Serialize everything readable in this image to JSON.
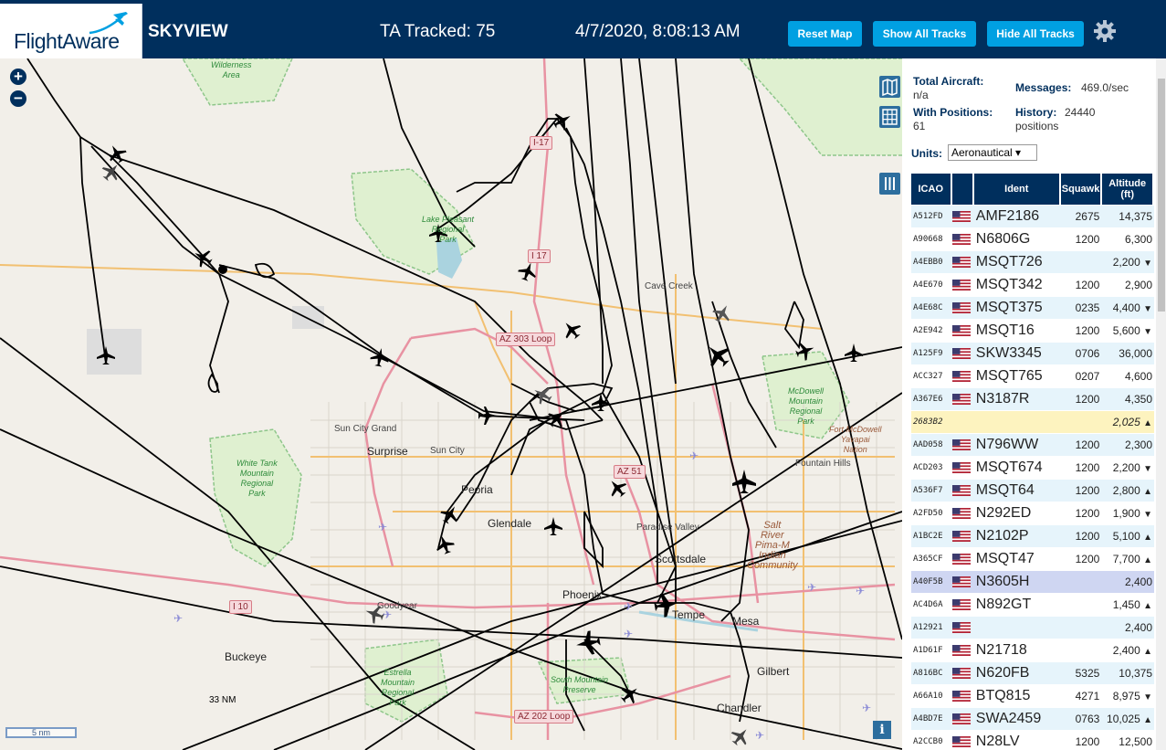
{
  "header": {
    "logo": "FlightAware",
    "title": "SKYVIEW",
    "tracked": "TA Tracked: 75",
    "clock": "4/7/2020, 8:08:13 AM",
    "buttons": {
      "reset": "Reset Map",
      "show": "Show All Tracks",
      "hide": "Hide All Tracks"
    }
  },
  "map": {
    "zoom_in": "+",
    "zoom_out": "−",
    "info": "i",
    "scale_33": "33 NM",
    "scale_bar": "5 nm",
    "labels": {
      "cave_creek": "Cave Creek",
      "sun_city_grand": "Sun City Grand",
      "surprise": "Surprise",
      "sun_city": "Sun City",
      "peoria": "Peoria",
      "glendale": "Glendale",
      "paradise_valley": "Paradise Valley",
      "scottsdale": "Scottsdale",
      "phoenix": "Phoenix",
      "tempe": "Tempe",
      "mesa": "Mesa",
      "gilbert": "Gilbert",
      "chandler": "Chandler",
      "goodyear": "Goodyear",
      "buckeye": "Buckeye",
      "fountain_hills": "Fountain Hills"
    },
    "parks": {
      "wilderness": "River Canyon\nWilderness\nArea",
      "lake_pleasant": "Lake Pleasant\nRegional\nPark",
      "white_tank": "White Tank\nMountain\nRegional\nPark",
      "mcdowell": "McDowell\nMountain\nRegional\nPark",
      "estrella": "Estrella\nMountain\nRegional\nPark",
      "south_mountain": "South Mountain\nPreserve"
    },
    "tribal": {
      "fort_mcdowell": "Fort McDowell\nYavapai\nNation",
      "salt_river": "Salt\nRiver\nPima-M\nIndian\nCommunity"
    },
    "shields": {
      "i17a": "I-17",
      "i17b": "I 17",
      "az303": "AZ 303 Loop",
      "az51": "AZ 51",
      "i10": "I 10",
      "az202": "AZ 202 Loop"
    }
  },
  "panel": {
    "total_aircraft_label": "Total Aircraft:",
    "total_aircraft_value": "n/a",
    "with_positions_label": "With Positions:",
    "with_positions_value": "61",
    "messages_label": "Messages:",
    "messages_value": "469.0/sec",
    "history_label": "History:",
    "history_value": "24440",
    "history_unit": "positions",
    "units_label": "Units:",
    "units_value": "Aeronautical ▾",
    "columns": {
      "icao": "ICAO",
      "ident": "Ident",
      "squawk": "Squawk",
      "altitude": "Altitude",
      "altitude_unit": "(ft)"
    },
    "rows": [
      {
        "icao": "A512FD",
        "ident": "AMF2186",
        "squawk": "2675",
        "alt": "14,375",
        "trend": ""
      },
      {
        "icao": "A90668",
        "ident": "N6806G",
        "squawk": "1200",
        "alt": "6,300",
        "trend": ""
      },
      {
        "icao": "A4EBB0",
        "ident": "MSQT726",
        "squawk": "",
        "alt": "2,200",
        "trend": "▼"
      },
      {
        "icao": "A4E670",
        "ident": "MSQT342",
        "squawk": "1200",
        "alt": "2,900",
        "trend": ""
      },
      {
        "icao": "A4E68C",
        "ident": "MSQT375",
        "squawk": "0235",
        "alt": "4,400",
        "trend": "▼"
      },
      {
        "icao": "A2E942",
        "ident": "MSQT16",
        "squawk": "1200",
        "alt": "5,600",
        "trend": "▼"
      },
      {
        "icao": "A125F9",
        "ident": "SKW3345",
        "squawk": "0706",
        "alt": "36,000",
        "trend": ""
      },
      {
        "icao": "ACC327",
        "ident": "MSQT765",
        "squawk": "0207",
        "alt": "4,600",
        "trend": ""
      },
      {
        "icao": "A367E6",
        "ident": "N3187R",
        "squawk": "1200",
        "alt": "4,350",
        "trend": ""
      },
      {
        "icao": "2683B2",
        "ident": "",
        "squawk": "",
        "alt": "2,025",
        "trend": "▲"
      },
      {
        "icao": "AAD058",
        "ident": "N796WW",
        "squawk": "1200",
        "alt": "2,300",
        "trend": ""
      },
      {
        "icao": "ACD203",
        "ident": "MSQT674",
        "squawk": "1200",
        "alt": "2,200",
        "trend": "▼"
      },
      {
        "icao": "A536F7",
        "ident": "MSQT64",
        "squawk": "1200",
        "alt": "2,800",
        "trend": "▲"
      },
      {
        "icao": "A2FD50",
        "ident": "N292ED",
        "squawk": "1200",
        "alt": "1,900",
        "trend": "▼"
      },
      {
        "icao": "A1BC2E",
        "ident": "N2102P",
        "squawk": "1200",
        "alt": "5,100",
        "trend": "▲"
      },
      {
        "icao": "A365CF",
        "ident": "MSQT47",
        "squawk": "1200",
        "alt": "7,700",
        "trend": "▲"
      },
      {
        "icao": "A40F5B",
        "ident": "N3605H",
        "squawk": "",
        "alt": "2,400",
        "trend": ""
      },
      {
        "icao": "AC4D6A",
        "ident": "N892GT",
        "squawk": "",
        "alt": "1,450",
        "trend": "▲"
      },
      {
        "icao": "A12921",
        "ident": "",
        "squawk": "",
        "alt": "2,400",
        "trend": ""
      },
      {
        "icao": "A1D61F",
        "ident": "N21718",
        "squawk": "",
        "alt": "2,400",
        "trend": "▲"
      },
      {
        "icao": "A816BC",
        "ident": "N620FB",
        "squawk": "5325",
        "alt": "10,375",
        "trend": ""
      },
      {
        "icao": "A66A10",
        "ident": "BTQ815",
        "squawk": "4271",
        "alt": "8,975",
        "trend": "▼"
      },
      {
        "icao": "A4BD7E",
        "ident": "SWA2459",
        "squawk": "0763",
        "alt": "10,025",
        "trend": "▲"
      },
      {
        "icao": "A2CCB0",
        "ident": "N28LV",
        "squawk": "1200",
        "alt": "12,500",
        "trend": ""
      }
    ]
  }
}
